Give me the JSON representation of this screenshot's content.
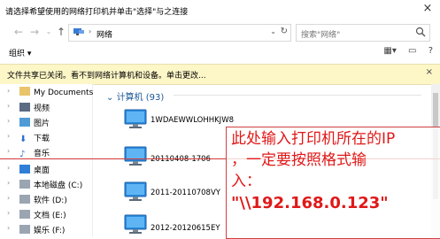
{
  "window": {
    "title": "请选择希望使用的网络打印机并单击\"选择\"与之连接",
    "close_label": "×"
  },
  "nav": {
    "back_icon": "arrow-left-icon",
    "forward_icon": "arrow-right-icon",
    "recent_icon": "chevron-down-icon",
    "up_icon": "arrow-up-icon",
    "address_crumb": "网络",
    "search_placeholder": "搜索\"网络\""
  },
  "toolbar": {
    "organize_label": "组织 ▾"
  },
  "infobar": {
    "text": "文件共享已关闭。看不到网络计算机和设备。单击更改...",
    "close_label": "×"
  },
  "sidebar": {
    "items": [
      {
        "label": "My Documents",
        "icon": "folder-icon"
      },
      {
        "label": "视频",
        "icon": "video-icon"
      },
      {
        "label": "图片",
        "icon": "picture-icon"
      },
      {
        "label": "下载",
        "icon": "download-icon"
      },
      {
        "label": "音乐",
        "icon": "music-icon"
      },
      {
        "label": "桌面",
        "icon": "desktop-icon"
      },
      {
        "label": "本地磁盘 (C:)",
        "icon": "drive-icon"
      },
      {
        "label": "软件 (D:)",
        "icon": "drive-icon"
      },
      {
        "label": "文档 (E:)",
        "icon": "drive-icon"
      },
      {
        "label": "娱乐 (F:)",
        "icon": "drive-icon"
      }
    ]
  },
  "main": {
    "group_header": "计算机 (93)",
    "computers": [
      {
        "name": "1WDAEWWLOHHKJW8"
      },
      {
        "name": "20110408-1706"
      },
      {
        "name": "2011-20110708VY"
      },
      {
        "name": "2012-20120615EY"
      }
    ]
  },
  "annotation": {
    "line1": "此处输入打印机所在的IP",
    "line2": "，一定要按照格式输",
    "line3": "入：",
    "line4": "\"\\\\192.168.0.123\""
  },
  "colors": {
    "annotation_red": "#e01818",
    "infobar_bg": "#fdf6c7",
    "group_blue": "#1b5797"
  }
}
